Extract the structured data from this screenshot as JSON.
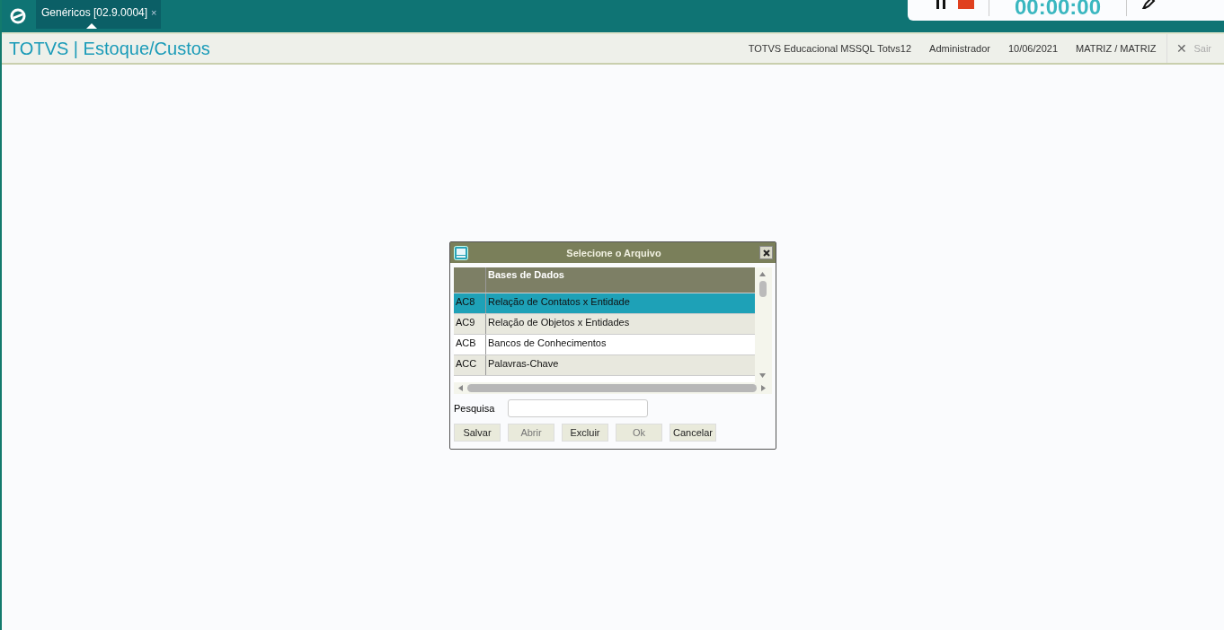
{
  "top_bar": {
    "tabs": [
      {
        "label": "Genéricos [02.9.0004]",
        "selected": true,
        "close": "×"
      }
    ]
  },
  "recorder": {
    "timer": "00:00:00"
  },
  "header": {
    "title": "TOTVS | Estoque/Custos",
    "info": [
      "TOTVS Educacional MSSQL Totvs12",
      "Administrador",
      "10/06/2021",
      "MATRIZ / MATRIZ"
    ],
    "exit": {
      "icon": "✕",
      "label": "Sair"
    }
  },
  "dialog": {
    "title": "Selecione o Arquivo",
    "table": {
      "columns": [
        "Bases de Dados"
      ],
      "rows": [
        {
          "code": "AC8",
          "name": "Relação de Contatos x Entidade",
          "selected": true
        },
        {
          "code": "AC9",
          "name": "Relação de Objetos x Entidades",
          "selected": false
        },
        {
          "code": "ACB",
          "name": "Bancos de Conhecimentos",
          "selected": false
        },
        {
          "code": "ACC",
          "name": "Palavras-Chave",
          "selected": false
        }
      ]
    },
    "search": {
      "label": "Pesquisa"
    },
    "buttons": [
      {
        "label": "Salvar",
        "disabled": false
      },
      {
        "label": "Abrir",
        "disabled": true
      },
      {
        "label": "Excluir",
        "disabled": false
      },
      {
        "label": "Ok",
        "disabled": true
      },
      {
        "label": "Cancelar",
        "disabled": false
      }
    ]
  }
}
